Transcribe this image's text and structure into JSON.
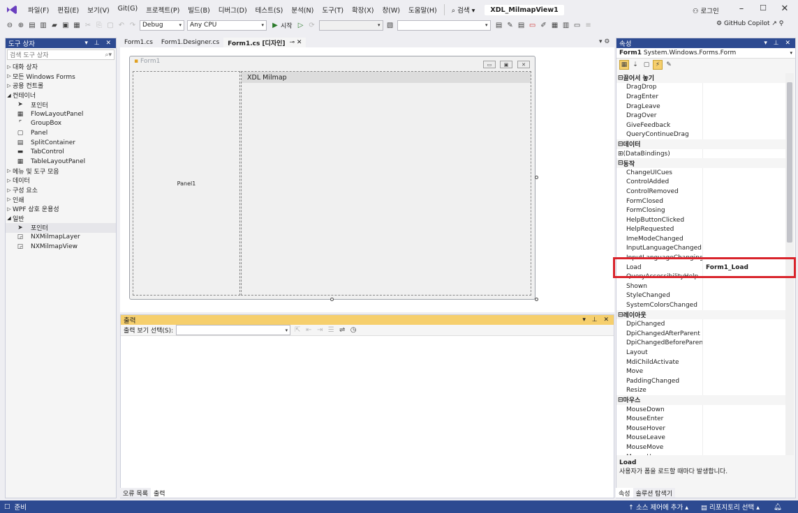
{
  "menubar": {
    "items": [
      "파일(F)",
      "편집(E)",
      "보기(V)",
      "Git(G)",
      "프로젝트(P)",
      "빌드(B)",
      "디버그(D)",
      "테스트(S)",
      "분석(N)",
      "도구(T)",
      "확장(X)",
      "창(W)",
      "도움말(H)"
    ],
    "search_label": "검색",
    "window_title": "XDL_MilmapView1",
    "login": "로그인"
  },
  "toolbar": {
    "config": "Debug",
    "platform": "Any CPU",
    "start": "시작",
    "copilot": "GitHub Copilot"
  },
  "toolbox": {
    "title": "도구 상자",
    "search_placeholder": "검색 도구 상자",
    "rows": [
      {
        "label": "대화 상자",
        "level": 0,
        "exp": "▷"
      },
      {
        "label": "모든 Windows Forms",
        "level": 0,
        "exp": "▷"
      },
      {
        "label": "공용 컨트롤",
        "level": 0,
        "exp": "▷"
      },
      {
        "label": "컨테이너",
        "level": 0,
        "exp": "◢"
      },
      {
        "label": "포인터",
        "level": 1,
        "icon": "pointer-icon"
      },
      {
        "label": "FlowLayoutPanel",
        "level": 1,
        "icon": "flowlayoutpanel-icon"
      },
      {
        "label": "GroupBox",
        "level": 1,
        "icon": "groupbox-icon"
      },
      {
        "label": "Panel",
        "level": 1,
        "icon": "panel-icon"
      },
      {
        "label": "SplitContainer",
        "level": 1,
        "icon": "splitcontainer-icon"
      },
      {
        "label": "TabControl",
        "level": 1,
        "icon": "tabcontrol-icon"
      },
      {
        "label": "TableLayoutPanel",
        "level": 1,
        "icon": "tablelayoutpanel-icon"
      },
      {
        "label": "메뉴 및 도구 모음",
        "level": 0,
        "exp": "▷"
      },
      {
        "label": "데이터",
        "level": 0,
        "exp": "▷"
      },
      {
        "label": "구성 요소",
        "level": 0,
        "exp": "▷"
      },
      {
        "label": "인쇄",
        "level": 0,
        "exp": "▷"
      },
      {
        "label": "WPF 상호 운용성",
        "level": 0,
        "exp": "▷"
      },
      {
        "label": "일반",
        "level": 0,
        "exp": "◢"
      },
      {
        "label": "포인터",
        "level": 1,
        "icon": "pointer-icon",
        "selected": true
      },
      {
        "label": "NXMilmapLayer",
        "level": 1,
        "icon": "component-icon"
      },
      {
        "label": "NXMilmapView",
        "level": 1,
        "icon": "component-icon"
      }
    ]
  },
  "doctabs": [
    {
      "label": "Form1.cs"
    },
    {
      "label": "Form1.Designer.cs"
    },
    {
      "label": "Form1.cs [디자인]",
      "active": true
    }
  ],
  "designer": {
    "form_title": "Form1",
    "panel_label": "Panel1",
    "map_header": "XDL Milmap"
  },
  "output": {
    "title": "출력",
    "source_label": "출력 보기 선택(S):"
  },
  "bottom_tabs": [
    {
      "label": "오류 목록"
    },
    {
      "label": "출력",
      "active": true
    }
  ],
  "props": {
    "title": "속성",
    "object_name": "Form1",
    "object_type": "System.Windows.Forms.Form",
    "rows": [
      {
        "cat": "끌어서 놓기"
      },
      {
        "k": "DragDrop"
      },
      {
        "k": "DragEnter"
      },
      {
        "k": "DragLeave"
      },
      {
        "k": "DragOver"
      },
      {
        "k": "GiveFeedback"
      },
      {
        "k": "QueryContinueDrag"
      },
      {
        "cat": "데이터"
      },
      {
        "k": "(DataBindings)",
        "plus": true
      },
      {
        "cat": "동작"
      },
      {
        "k": "ChangeUICues"
      },
      {
        "k": "ControlAdded"
      },
      {
        "k": "ControlRemoved"
      },
      {
        "k": "FormClosed"
      },
      {
        "k": "FormClosing"
      },
      {
        "k": "HelpButtonClicked"
      },
      {
        "k": "HelpRequested"
      },
      {
        "k": "ImeModeChanged"
      },
      {
        "k": "InputLanguageChanged"
      },
      {
        "k": "InputLanguageChanging"
      },
      {
        "k": "Load",
        "v": "Form1_Load",
        "sel": true
      },
      {
        "k": "QueryAccessibilityHelp"
      },
      {
        "k": "Shown"
      },
      {
        "k": "StyleChanged"
      },
      {
        "k": "SystemColorsChanged"
      },
      {
        "cat": "레이아웃"
      },
      {
        "k": "DpiChanged"
      },
      {
        "k": "DpiChangedAfterParent"
      },
      {
        "k": "DpiChangedBeforeParent"
      },
      {
        "k": "Layout"
      },
      {
        "k": "MdiChildActivate"
      },
      {
        "k": "Move"
      },
      {
        "k": "PaddingChanged"
      },
      {
        "k": "Resize"
      },
      {
        "cat": "마우스"
      },
      {
        "k": "MouseDown"
      },
      {
        "k": "MouseEnter"
      },
      {
        "k": "MouseHover"
      },
      {
        "k": "MouseLeave"
      },
      {
        "k": "MouseMove"
      },
      {
        "k": "MouseUp"
      }
    ],
    "desc_title": "Load",
    "desc_text": "사용자가 폼을 로드할 때마다 발생합니다."
  },
  "prop_tabs": [
    {
      "label": "속성",
      "active": true
    },
    {
      "label": "솔루션 탐색기"
    }
  ],
  "status": {
    "ready": "준비",
    "source_control": "소스 제어에 추가",
    "repo": "리포지토리 선택"
  },
  "colors": {
    "accent": "#2d4a91",
    "highlight": "#d9232b",
    "tab_active": "#f6cf6d"
  }
}
